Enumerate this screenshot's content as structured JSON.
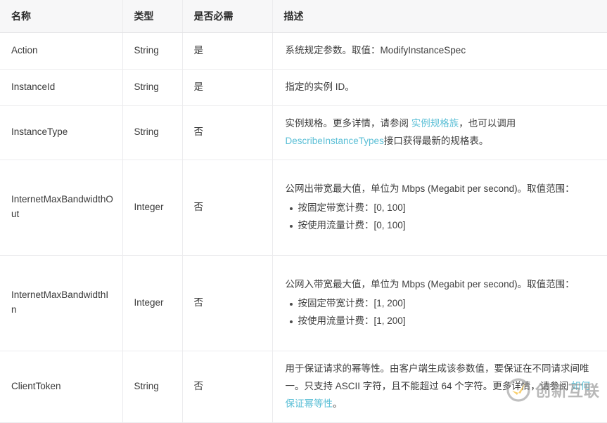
{
  "table": {
    "headers": [
      "名称",
      "类型",
      "是否必需",
      "描述"
    ],
    "rows": [
      {
        "name": "Action",
        "type": "String",
        "required": "是",
        "desc_parts": [
          {
            "kind": "text",
            "text": "系统规定参数。取值：ModifyInstanceSpec"
          }
        ]
      },
      {
        "name": "InstanceId",
        "type": "String",
        "required": "是",
        "desc_parts": [
          {
            "kind": "text",
            "text": "指定的实例 ID。"
          }
        ]
      },
      {
        "name": "InstanceType",
        "type": "String",
        "required": "否",
        "desc_parts": [
          {
            "kind": "text",
            "text": "实例规格。更多详情，请参阅 "
          },
          {
            "kind": "link",
            "text": "实例规格族"
          },
          {
            "kind": "text",
            "text": "，也可以调用 "
          },
          {
            "kind": "link",
            "text": "DescribeInstanceTypes"
          },
          {
            "kind": "text",
            "text": "接口获得最新的规格表。"
          }
        ]
      },
      {
        "name": "InternetMaxBandwidthOut",
        "type": "Integer",
        "required": "否",
        "desc_parts": [
          {
            "kind": "text",
            "text": "公网出带宽最大值，单位为 Mbps (Megabit per second)。取值范围："
          }
        ],
        "bullets": [
          "按固定带宽计费：[0, 100]",
          "按使用流量计费：[0, 100]"
        ]
      },
      {
        "name": "InternetMaxBandwidthIn",
        "type": "Integer",
        "required": "否",
        "desc_parts": [
          {
            "kind": "text",
            "text": "公网入带宽最大值，单位为 Mbps (Megabit per second)。取值范围："
          }
        ],
        "bullets": [
          "按固定带宽计费：[1, 200]",
          "按使用流量计费：[1, 200]"
        ]
      },
      {
        "name": "ClientToken",
        "type": "String",
        "required": "否",
        "desc_parts": [
          {
            "kind": "text",
            "text": "用于保证请求的幂等性。由客户端生成该参数值，要保证在不同请求间唯一。只支持 ASCII 字符，且不能超过 64 个字符。更多详情，请参阅 "
          },
          {
            "kind": "link",
            "text": "如何保证幂等性"
          },
          {
            "kind": "text",
            "text": "。"
          }
        ]
      }
    ]
  },
  "watermark": {
    "text": "创新互联",
    "logo_icon": "circle-check-swoosh-icon"
  },
  "colors": {
    "link": "#5bbfd6",
    "header_bg": "#f7f7f8",
    "border": "#ececee",
    "text": "#3a3a3a",
    "watermark_text": "#8d8d8d",
    "watermark_accent": "#f5b316"
  }
}
